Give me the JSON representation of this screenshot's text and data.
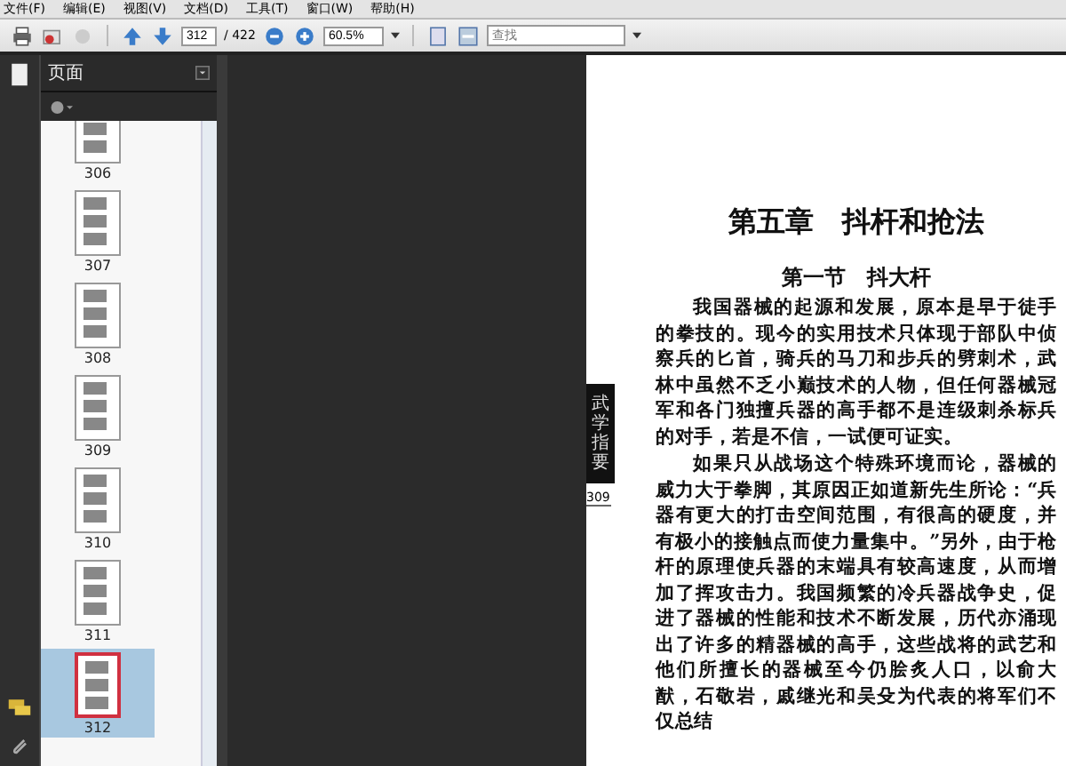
{
  "menu": [
    "文件(F)",
    "编辑(E)",
    "视图(V)",
    "文档(D)",
    "工具(T)",
    "窗口(W)",
    "帮助(H)"
  ],
  "toolbar": {
    "page_number": "312",
    "page_total": "/ 422",
    "zoom": "60.5%",
    "search": {
      "placeholder": "查找"
    }
  },
  "panel": {
    "title": "页面"
  },
  "thumbnails": [
    {
      "label": "306",
      "selected": false
    },
    {
      "label": "307",
      "selected": false
    },
    {
      "label": "308",
      "selected": false
    },
    {
      "label": "309",
      "selected": false
    },
    {
      "label": "310",
      "selected": false
    },
    {
      "label": "311",
      "selected": false
    },
    {
      "label": "312",
      "selected": true
    }
  ],
  "document": {
    "side_tab": "武学指要",
    "side_page": "309",
    "chapter_title": "第五章　抖杆和抢法",
    "section_title": "第一节　抖大杆",
    "paragraphs": [
      "我国器械的起源和发展，原本是早于徒手的拳技的。现今的实用技术只体现于部队中侦察兵的匕首，骑兵的马刀和步兵的劈刺术，武林中虽然不乏小巅技术的人物，但任何器械冠军和各门独擅兵器的高手都不是连级刺杀标兵的对手，若是不信，一试便可证实。",
      "如果只从战场这个特殊环境而论，器械的威力大于拳脚，其原因正如道新先生所论：“兵器有更大的打击空间范围，有很高的硬度，并有极小的接触点而使力量集中。”另外，由于枪杆的原理使兵器的末端具有较高速度，从而增加了挥攻击力。我国频繁的冷兵器战争史，促进了器械的性能和技术不断发展，历代亦涌现出了许多的精器械的高手，这些战将的武艺和他们所擅长的器械至今仍脍炙人口，以俞大猷，石敬岩，戚继光和吴殳为代表的将军们不仅总结"
    ]
  }
}
